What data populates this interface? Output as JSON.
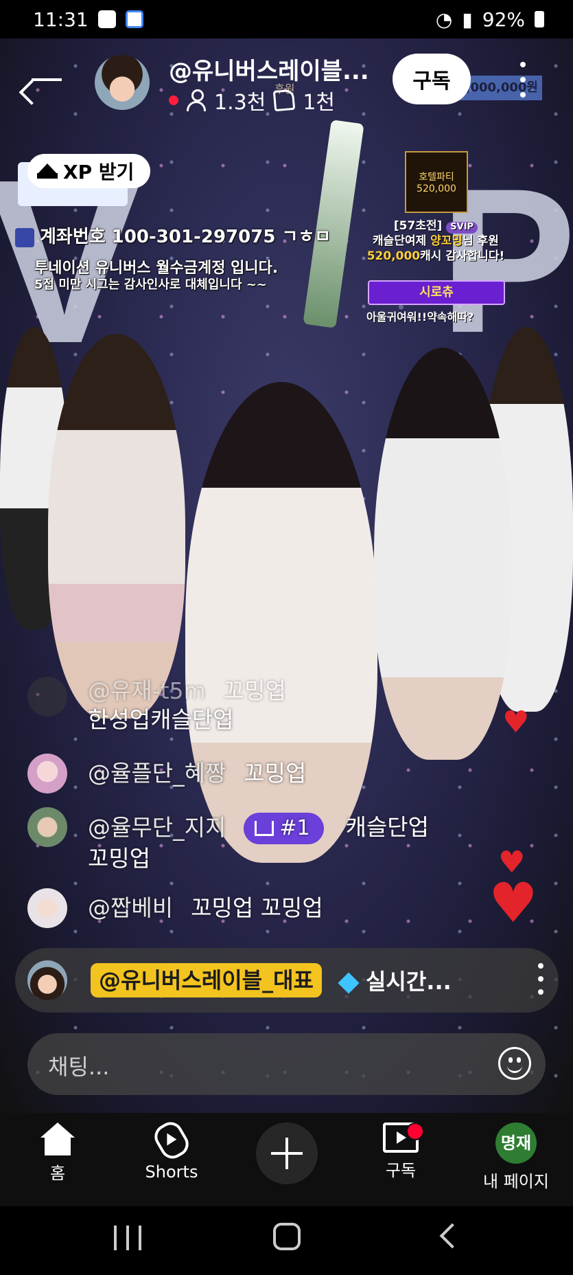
{
  "status_bar": {
    "time": "11:31",
    "battery": "92%"
  },
  "header": {
    "channel_name": "@유니버스레이블...",
    "viewers": "1.3천",
    "likes": "1천",
    "subscribe_label": "구독"
  },
  "stream_overlay": {
    "xp_button": "XP 받기",
    "account_line": "계좌번호 100-301-297075 ㄱㅎㅁ",
    "notice_1": "투네이션 유니버스 월수금계정 입니다.",
    "notice_2": "5접 미만 시그는 감사인사로 대체입니다 ~~",
    "party_title": "호텔파티",
    "party_amount": "520,000",
    "donation_header": "[57초전]",
    "donation_svip": "SVIP",
    "donation_line_1a": "캐슬단여제",
    "donation_line_1b": "양꼬밍",
    "donation_line_1c": "님 후원",
    "donation_amount": "520,000",
    "donation_line_2": "캐시 감사합니다!",
    "event_bar": "시로츄",
    "promise_text": "아울귀여워!!약속해따?",
    "ticker_left": "후원",
    "ticker_right": "0,000,000원"
  },
  "chat": {
    "messages": [
      {
        "user": "@유재-t5m",
        "text": "꼬밍업",
        "extra": "한성업캐슬단업"
      },
      {
        "user": "@율플단_혜짱",
        "text": "꼬밍업"
      },
      {
        "user": "@율무단_지지",
        "badge": "#1",
        "text": "캐슬단업",
        "extra": "꼬밍업"
      },
      {
        "user": "@짭베비",
        "text": "꼬밍업 꼬밍업"
      }
    ],
    "pinned": {
      "user": "@유니버스레이블_대표",
      "text": "실시간..."
    },
    "input_placeholder": "채팅..."
  },
  "bottom_nav": {
    "home": "홈",
    "shorts": "Shorts",
    "subscriptions": "구독",
    "my_page": "내 페이지",
    "avatar_initials": "명재"
  }
}
